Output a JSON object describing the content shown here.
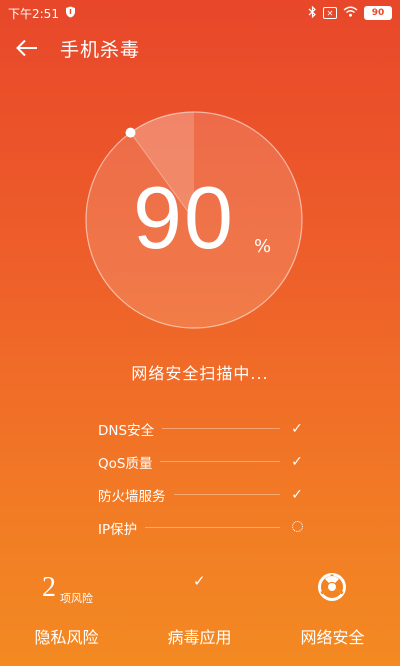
{
  "status_bar": {
    "time": "下午2:51",
    "battery": "90"
  },
  "app_bar": {
    "title": "手机杀毒"
  },
  "scan": {
    "percent": "90",
    "percent_sign": "%",
    "progress_fraction": 0.9,
    "status_text": "网络安全扫描中..."
  },
  "checks": [
    {
      "label": "DNS安全",
      "state": "done"
    },
    {
      "label": "QoS质量",
      "state": "done"
    },
    {
      "label": "防火墙服务",
      "state": "done"
    },
    {
      "label": "IP保护",
      "state": "scanning"
    }
  ],
  "bottom": {
    "privacy": {
      "count": "2",
      "unit": "项风险",
      "label": "隐私风险"
    },
    "virus": {
      "label": "病毒应用"
    },
    "network": {
      "label": "网络安全"
    }
  },
  "colors": {
    "background_top": "#e8472a",
    "background_bottom": "#f38a22"
  }
}
